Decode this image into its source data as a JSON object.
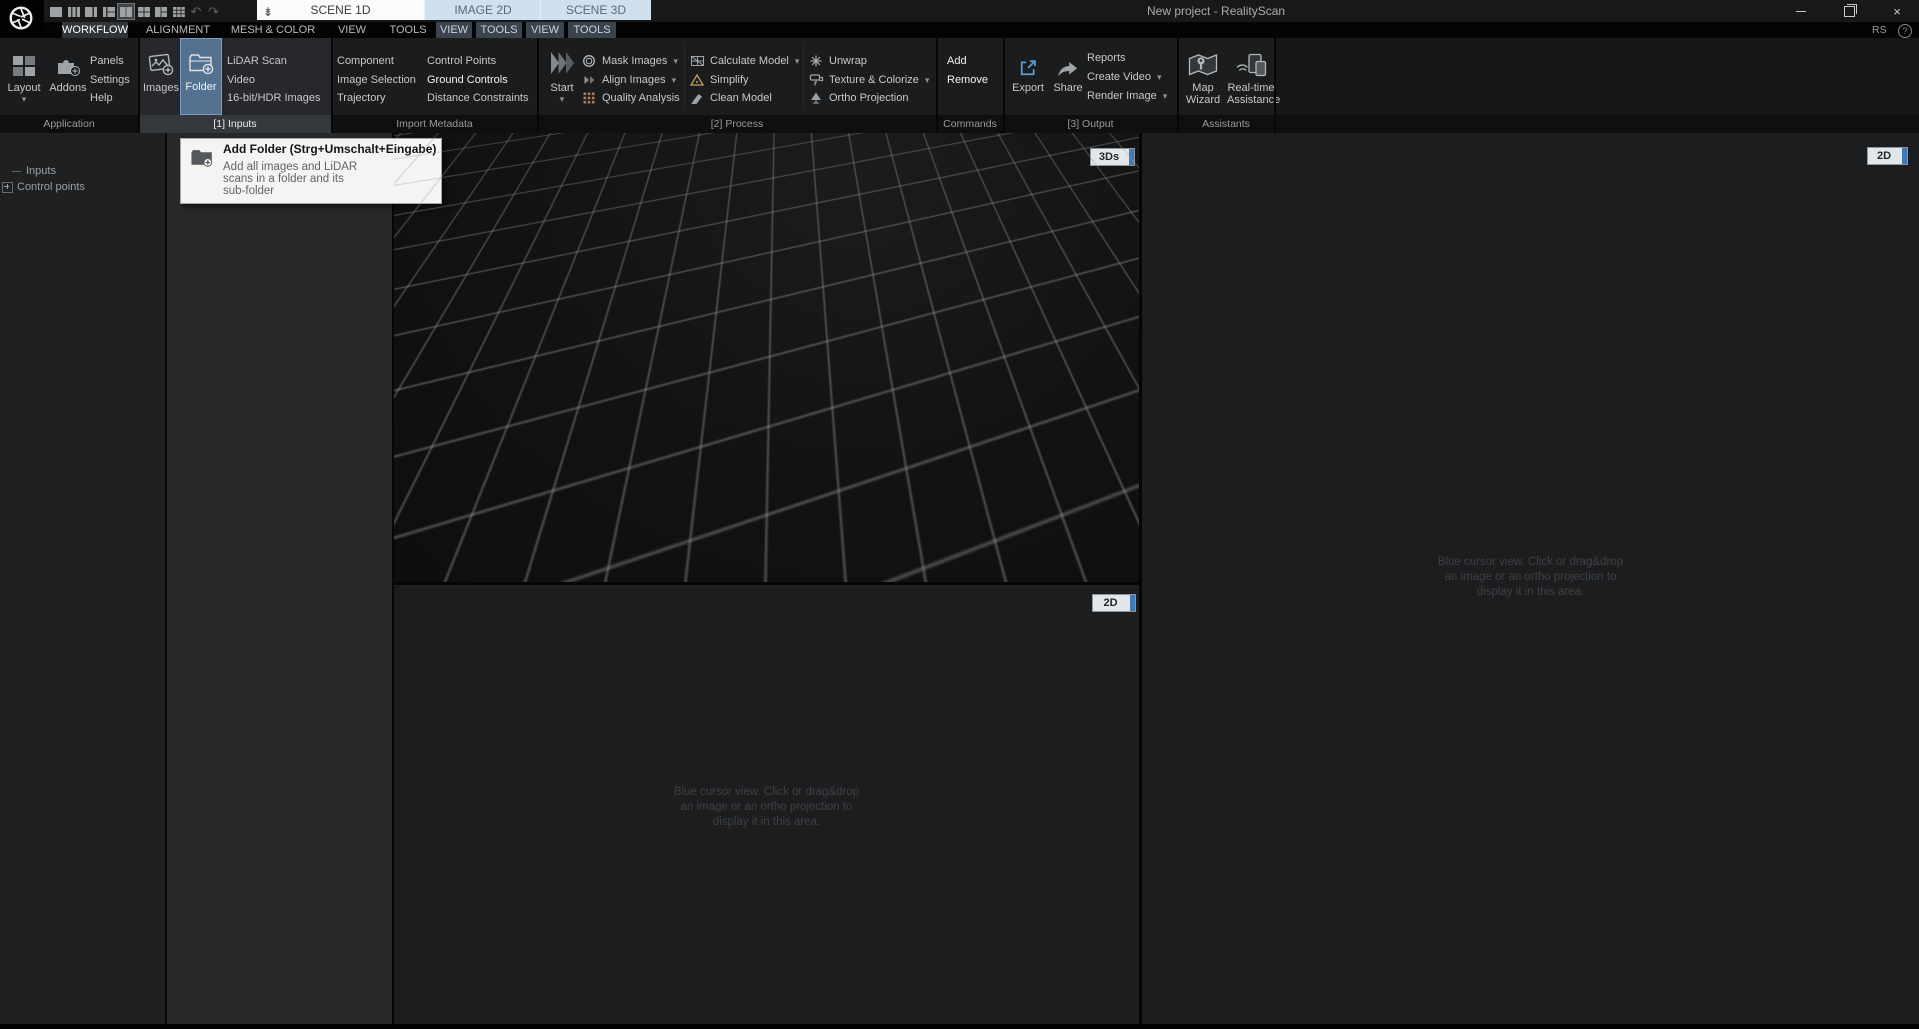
{
  "titlebar": {
    "title": "New project - RealityScan",
    "logo": "realityscan-aperture-logo",
    "window_controls": {
      "minimize": "minimize",
      "maximize": "maximize-restore",
      "close": "close"
    },
    "quick_toolbar_icons": [
      "layout-single-icon",
      "layout-three-columns-icon",
      "layout-left-wide-icon",
      "layout-right-split-icon",
      "layout-two-columns-icon",
      "layout-grid-2x2-icon",
      "layout-left-tall-icon",
      "layout-grid-3x3-icon",
      "undo-icon",
      "redo-icon"
    ],
    "collapse_icon": "collapse-ribbon-icon"
  },
  "view_tabs": {
    "scene1d": "SCENE 1D",
    "image2d": "IMAGE 2D",
    "scene3d": "SCENE 3D"
  },
  "ribbon_tabs": {
    "main": [
      "WORKFLOW",
      "ALIGNMENT",
      "MESH & COLOR",
      "VIEW",
      "TOOLS"
    ],
    "context": [
      "VIEW",
      "TOOLS",
      "VIEW",
      "TOOLS"
    ],
    "user_badge": "RS",
    "help_icon": "help-icon"
  },
  "ribbon": {
    "application": {
      "label": "Application",
      "big": [
        {
          "icon": "layout-icon",
          "label": "Layout",
          "dropdown": true
        },
        {
          "icon": "addons-icon",
          "label": "Addons",
          "dropdown": false
        }
      ],
      "links": [
        {
          "label": "Panels"
        },
        {
          "label": "Settings"
        },
        {
          "label": "Help"
        }
      ]
    },
    "inputs": {
      "label": "[1] Inputs",
      "big": [
        {
          "icon": "add-images-icon",
          "label": "Images"
        },
        {
          "icon": "add-folder-icon",
          "label": "Folder",
          "selected": true
        }
      ],
      "links": [
        {
          "label": "LiDAR Scan"
        },
        {
          "label": "Video"
        },
        {
          "label": "16-bit/HDR Images"
        }
      ]
    },
    "import_metadata": {
      "label": "Import Metadata",
      "col1": [
        {
          "label": "Component"
        },
        {
          "label": "Image Selection"
        },
        {
          "label": "Trajectory"
        }
      ],
      "col2": [
        {
          "label": "Control Points"
        },
        {
          "label": "Ground Controls"
        },
        {
          "label": "Distance Constraints"
        }
      ]
    },
    "process": {
      "label": "[2] Process",
      "start": {
        "icon": "start-icon",
        "label": "Start",
        "dropdown": true
      },
      "col1": [
        {
          "icon": "mask-icon",
          "label": "Mask Images",
          "dropdown": true
        },
        {
          "icon": "align-icon",
          "label": "Align Images",
          "dropdown": true
        },
        {
          "icon": "quality-icon",
          "label": "Quality Analysis",
          "dropdown": false
        }
      ],
      "col2": [
        {
          "icon": "calculate-model-icon",
          "label": "Calculate Model",
          "dropdown": true
        },
        {
          "icon": "simplify-icon",
          "label": "Simplify",
          "dropdown": false
        },
        {
          "icon": "clean-model-icon",
          "label": "Clean Model",
          "dropdown": false
        }
      ],
      "col3": [
        {
          "icon": "unwrap-icon",
          "label": "Unwrap",
          "dropdown": false
        },
        {
          "icon": "texture-colorize-icon",
          "label": "Texture & Colorize",
          "dropdown": true
        },
        {
          "icon": "ortho-projection-icon",
          "label": "Ortho Projection",
          "dropdown": false
        }
      ]
    },
    "commands": {
      "label": "Commands",
      "items": [
        {
          "label": "Add"
        },
        {
          "label": "Remove"
        }
      ]
    },
    "output": {
      "label": "[3] Output",
      "big": [
        {
          "icon": "export-icon",
          "label": "Export"
        },
        {
          "icon": "share-icon",
          "label": "Share"
        }
      ],
      "links": [
        {
          "label": "Reports",
          "dropdown": false
        },
        {
          "label": "Create Video",
          "dropdown": true
        },
        {
          "label": "Render Image",
          "dropdown": true
        }
      ]
    },
    "assistants": {
      "label": "Assistants",
      "big": [
        {
          "icon": "map-wizard-icon",
          "label": "Map Wizard"
        },
        {
          "icon": "realtime-assistance-icon",
          "label": "Real-time Assistance"
        }
      ]
    }
  },
  "tooltip": {
    "icon": "add-folder-icon",
    "title": "Add Folder (Strg+Umschalt+Eingabe)",
    "lines": [
      "Add all images and LiDAR",
      "scans in a folder and its",
      "sub-folder"
    ]
  },
  "tree": {
    "items": [
      {
        "label": "Inputs"
      },
      {
        "label": "Control points",
        "expandable": true
      }
    ]
  },
  "viewports": {
    "scene3d_badge": "3Ds",
    "image2d_badge": "2D",
    "right2d_badge": "2D",
    "hint_lines": [
      "Blue cursor view. Click or drag&drop",
      "an image or an ortho projection to",
      "display it in this area."
    ]
  },
  "colors": {
    "selection_blue": "#54718f",
    "tab_blue": "#cfe0ef",
    "export_blue": "#5a9bd5",
    "badge_strip_blue": "#3f7ab8"
  }
}
